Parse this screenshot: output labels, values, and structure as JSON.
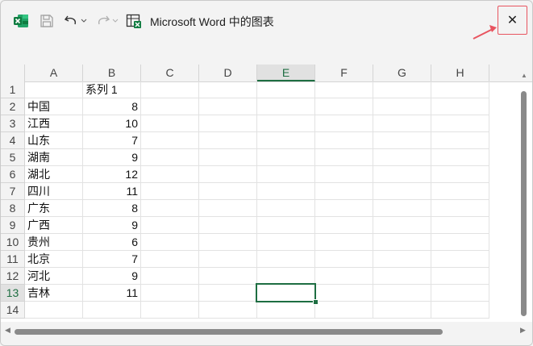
{
  "window": {
    "title": "Microsoft Word 中的图表",
    "close_label": "✕"
  },
  "toolbar": {
    "icons": [
      "excel-icon",
      "save-icon",
      "undo-icon",
      "redo-icon",
      "edit-data-in-excel-icon"
    ]
  },
  "sheet": {
    "columns": [
      "A",
      "B",
      "C",
      "D",
      "E",
      "F",
      "G",
      "H"
    ],
    "rows": [
      "1",
      "2",
      "3",
      "4",
      "5",
      "6",
      "7",
      "8",
      "9",
      "10",
      "11",
      "12",
      "13",
      "14"
    ],
    "selected_column": "E",
    "selected_row": "13",
    "selected_cell": "E13",
    "header_row": {
      "a": "",
      "b": "系列 1"
    },
    "data": [
      {
        "a": "中国",
        "b": "8"
      },
      {
        "a": "江西",
        "b": "10"
      },
      {
        "a": "山东",
        "b": "7"
      },
      {
        "a": "湖南",
        "b": "9"
      },
      {
        "a": "湖北",
        "b": "12"
      },
      {
        "a": "四川",
        "b": "11"
      },
      {
        "a": "广东",
        "b": "8"
      },
      {
        "a": "广西",
        "b": "9"
      },
      {
        "a": "贵州",
        "b": "6"
      },
      {
        "a": "北京",
        "b": "7"
      },
      {
        "a": "河北",
        "b": "9"
      },
      {
        "a": "吉林",
        "b": "11"
      }
    ]
  },
  "colors": {
    "accent_green": "#1e6e42",
    "highlight_red": "#e8545f"
  }
}
